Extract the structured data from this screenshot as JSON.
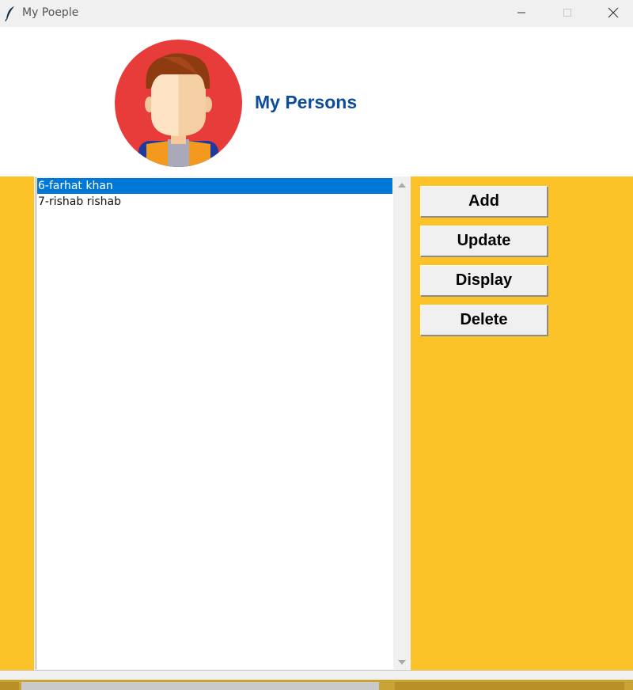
{
  "window": {
    "title": "My Poeple"
  },
  "header": {
    "title": "My Persons"
  },
  "listbox": {
    "items": [
      "6-farhat khan",
      "7-rishab rishab"
    ],
    "selected_index": 0
  },
  "buttons": {
    "add": "Add",
    "update": "Update",
    "display": "Display",
    "delete": "Delete"
  },
  "colors": {
    "background": "#fbc327",
    "title_text": "#0b4d9b",
    "selection": "#0078d7",
    "avatar_circle": "#e83c3a"
  },
  "icons": {
    "app": "feather-icon",
    "avatar": "person-avatar",
    "minimize": "minimize-icon",
    "maximize": "maximize-icon",
    "close": "close-icon"
  }
}
